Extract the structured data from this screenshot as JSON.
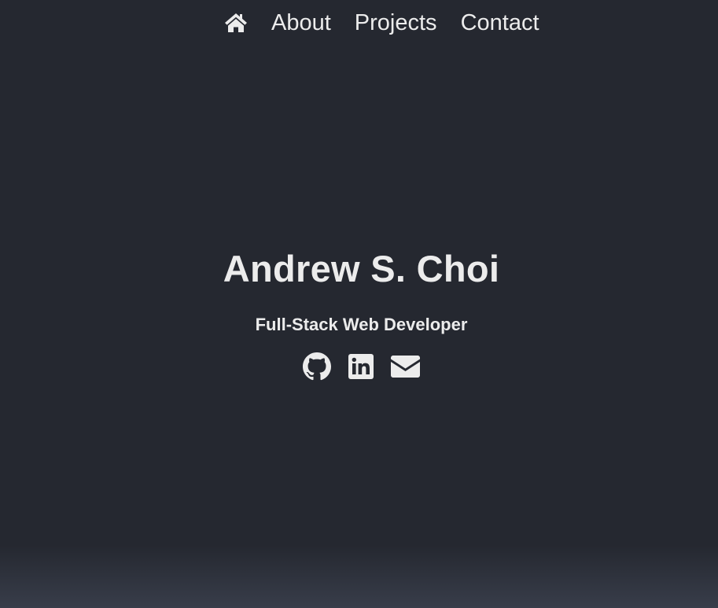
{
  "nav": {
    "home_icon": "home-icon",
    "links": [
      {
        "label": "About"
      },
      {
        "label": "Projects"
      },
      {
        "label": "Contact"
      }
    ]
  },
  "hero": {
    "name": "Andrew S. Choi",
    "role": "Full-Stack Web Developer"
  },
  "socials": [
    {
      "icon": "github-icon"
    },
    {
      "icon": "linkedin-icon"
    },
    {
      "icon": "envelope-icon"
    }
  ],
  "colors": {
    "background": "#252830",
    "text": "#ececec",
    "bottom_fade": "#383d4a"
  }
}
